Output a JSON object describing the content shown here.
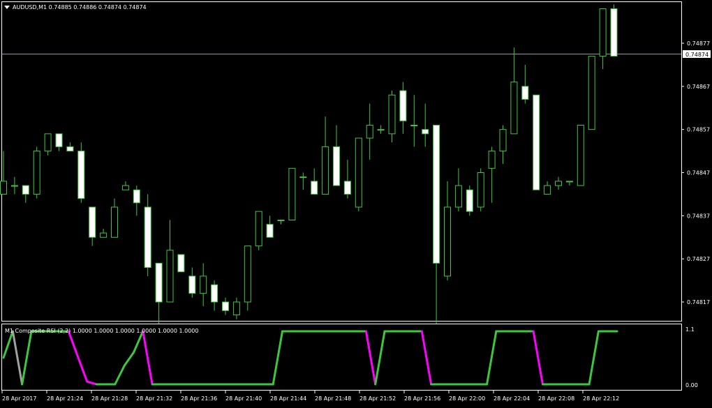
{
  "header": {
    "symbol_line": "AUDUSD,M1  0.74885 0.74886 0.74874 0.74874"
  },
  "indicator": {
    "title": "M1 Composite RSI (2,2) 1.0000 1.0000 1.0000 1.0000 1.0000 1.0000",
    "scale_top": "1.1",
    "scale_bottom": "0.00",
    "rising_color": "#3cc83c",
    "falling_color": "#ff00ff",
    "neutral_color": "#a0a0a0"
  },
  "price_axis": {
    "labels": [
      "0.74877",
      "0.74867",
      "0.74857",
      "0.74847",
      "0.74837",
      "0.74827",
      "0.74817"
    ],
    "current_price": "0.74874"
  },
  "time_axis": {
    "labels": [
      "28 Apr 2017",
      "28 Apr 21:24",
      "28 Apr 21:28",
      "28 Apr 21:32",
      "28 Apr 21:36",
      "28 Apr 21:40",
      "28 Apr 21:44",
      "28 Apr 21:48",
      "28 Apr 21:52",
      "28 Apr 21:56",
      "28 Apr 22:00",
      "28 Apr 22:04",
      "28 Apr 22:08",
      "28 Apr 22:12"
    ]
  },
  "colors": {
    "background": "#000000",
    "bull_candle_body": "#000000",
    "bear_candle_body": "#ffffff",
    "candle_outline": "#3cc83c",
    "grid_frame": "#ffffff",
    "bid_line": "#8a9bb0"
  },
  "chart_data": {
    "type": "candlestick",
    "price_range": [
      0.74812,
      0.74886
    ],
    "candles": [
      {
        "o": 0.74842,
        "h": 0.74852,
        "l": 0.74842,
        "c": 0.74845
      },
      {
        "o": 0.74844,
        "h": 0.74846,
        "l": 0.74842,
        "c": 0.74844
      },
      {
        "o": 0.74844,
        "h": 0.74844,
        "l": 0.7484,
        "c": 0.74842
      },
      {
        "o": 0.74842,
        "h": 0.74853,
        "l": 0.74841,
        "c": 0.74852
      },
      {
        "o": 0.74852,
        "h": 0.74856,
        "l": 0.74851,
        "c": 0.74856
      },
      {
        "o": 0.74856,
        "h": 0.74856,
        "l": 0.74852,
        "c": 0.74853
      },
      {
        "o": 0.74853,
        "h": 0.74854,
        "l": 0.74852,
        "c": 0.74852
      },
      {
        "o": 0.74852,
        "h": 0.74854,
        "l": 0.7484,
        "c": 0.74841
      },
      {
        "o": 0.74839,
        "h": 0.74839,
        "l": 0.7483,
        "c": 0.74832
      },
      {
        "o": 0.74832,
        "h": 0.74834,
        "l": 0.74832,
        "c": 0.74833
      },
      {
        "o": 0.74832,
        "h": 0.74841,
        "l": 0.74832,
        "c": 0.74839
      },
      {
        "o": 0.74843,
        "h": 0.74845,
        "l": 0.74843,
        "c": 0.74844
      },
      {
        "o": 0.74843,
        "h": 0.74844,
        "l": 0.74837,
        "c": 0.7484
      },
      {
        "o": 0.74839,
        "h": 0.74842,
        "l": 0.74823,
        "c": 0.74825
      },
      {
        "o": 0.74826,
        "h": 0.74826,
        "l": 0.74812,
        "c": 0.74817
      },
      {
        "o": 0.74817,
        "h": 0.74836,
        "l": 0.74817,
        "c": 0.74829
      },
      {
        "o": 0.74828,
        "h": 0.74828,
        "l": 0.74824,
        "c": 0.74824
      },
      {
        "o": 0.74823,
        "h": 0.74825,
        "l": 0.74818,
        "c": 0.74819
      },
      {
        "o": 0.74819,
        "h": 0.74826,
        "l": 0.74816,
        "c": 0.74823
      },
      {
        "o": 0.74821,
        "h": 0.74822,
        "l": 0.74815,
        "c": 0.74817
      },
      {
        "o": 0.74817,
        "h": 0.74818,
        "l": 0.74814,
        "c": 0.74815
      },
      {
        "o": 0.74814,
        "h": 0.74818,
        "l": 0.74813,
        "c": 0.74817
      },
      {
        "o": 0.74817,
        "h": 0.7483,
        "l": 0.74815,
        "c": 0.7483
      },
      {
        "o": 0.7483,
        "h": 0.74838,
        "l": 0.74829,
        "c": 0.74838
      },
      {
        "o": 0.74835,
        "h": 0.74837,
        "l": 0.74832,
        "c": 0.74832
      },
      {
        "o": 0.74836,
        "h": 0.74836,
        "l": 0.74835,
        "c": 0.74836
      },
      {
        "o": 0.74836,
        "h": 0.74848,
        "l": 0.74836,
        "c": 0.74848
      },
      {
        "o": 0.74846,
        "h": 0.74847,
        "l": 0.74843,
        "c": 0.74846
      },
      {
        "o": 0.74845,
        "h": 0.74848,
        "l": 0.74842,
        "c": 0.74842
      },
      {
        "o": 0.74842,
        "h": 0.7486,
        "l": 0.74842,
        "c": 0.74853
      },
      {
        "o": 0.74853,
        "h": 0.74858,
        "l": 0.74844,
        "c": 0.74844
      },
      {
        "o": 0.74845,
        "h": 0.7485,
        "l": 0.74841,
        "c": 0.74842
      },
      {
        "o": 0.74839,
        "h": 0.74855,
        "l": 0.74838,
        "c": 0.74855
      },
      {
        "o": 0.74855,
        "h": 0.74863,
        "l": 0.7485,
        "c": 0.74858
      },
      {
        "o": 0.74857,
        "h": 0.74858,
        "l": 0.74856,
        "c": 0.74857
      },
      {
        "o": 0.74856,
        "h": 0.74866,
        "l": 0.74854,
        "c": 0.74865
      },
      {
        "o": 0.74866,
        "h": 0.74868,
        "l": 0.74856,
        "c": 0.74859
      },
      {
        "o": 0.74858,
        "h": 0.74865,
        "l": 0.74853,
        "c": 0.74858
      },
      {
        "o": 0.74857,
        "h": 0.74863,
        "l": 0.74853,
        "c": 0.74856
      },
      {
        "o": 0.74858,
        "h": 0.74858,
        "l": 0.74812,
        "c": 0.74826
      },
      {
        "o": 0.74823,
        "h": 0.74845,
        "l": 0.74822,
        "c": 0.74839
      },
      {
        "o": 0.74839,
        "h": 0.74848,
        "l": 0.74838,
        "c": 0.74844
      },
      {
        "o": 0.74843,
        "h": 0.74844,
        "l": 0.74837,
        "c": 0.74838
      },
      {
        "o": 0.74839,
        "h": 0.74848,
        "l": 0.74838,
        "c": 0.74847
      },
      {
        "o": 0.74848,
        "h": 0.74853,
        "l": 0.7484,
        "c": 0.74852
      },
      {
        "o": 0.74852,
        "h": 0.74858,
        "l": 0.74849,
        "c": 0.74857
      },
      {
        "o": 0.74856,
        "h": 0.74876,
        "l": 0.74856,
        "c": 0.74868
      },
      {
        "o": 0.74867,
        "h": 0.74872,
        "l": 0.74863,
        "c": 0.74864
      },
      {
        "o": 0.74865,
        "h": 0.74865,
        "l": 0.74843,
        "c": 0.74843
      },
      {
        "o": 0.74842,
        "h": 0.74845,
        "l": 0.74842,
        "c": 0.74844
      },
      {
        "o": 0.74844,
        "h": 0.74846,
        "l": 0.74843,
        "c": 0.74845
      },
      {
        "o": 0.74845,
        "h": 0.74845,
        "l": 0.74844,
        "c": 0.74845
      },
      {
        "o": 0.74844,
        "h": 0.74858,
        "l": 0.74844,
        "c": 0.74858
      },
      {
        "o": 0.74857,
        "h": 0.74874,
        "l": 0.74857,
        "c": 0.74874
      },
      {
        "o": 0.74874,
        "h": 0.74885,
        "l": 0.74871,
        "c": 0.74885
      },
      {
        "o": 0.74885,
        "h": 0.74886,
        "l": 0.74874,
        "c": 0.74874
      }
    ],
    "rsi_values": [
      0.5,
      1.0,
      0.0,
      1.0,
      1.0,
      1.0,
      1.0,
      1.0,
      0.52,
      0.05,
      0.0,
      0.0,
      0.0,
      0.35,
      0.6,
      1.0,
      0.0,
      0.0,
      0.0,
      0.0,
      0.0,
      0.0,
      0.0,
      0.0,
      0.0,
      0.0,
      0.0,
      0.0,
      0.0,
      0.0,
      1.0,
      1.0,
      1.0,
      1.0,
      1.0,
      1.0,
      1.0,
      1.0,
      1.0,
      1.0,
      0.0,
      1.0,
      1.0,
      1.0,
      1.0,
      1.0,
      0.0,
      0.0,
      0.0,
      0.0,
      0.0,
      0.0,
      0.0,
      1.0,
      1.0,
      1.0,
      1.0,
      1.0,
      0.0,
      0.0,
      0.0,
      0.0,
      0.0,
      0.0,
      1.0,
      1.0,
      1.0
    ],
    "rsi_range": [
      0.0,
      1.1
    ]
  }
}
